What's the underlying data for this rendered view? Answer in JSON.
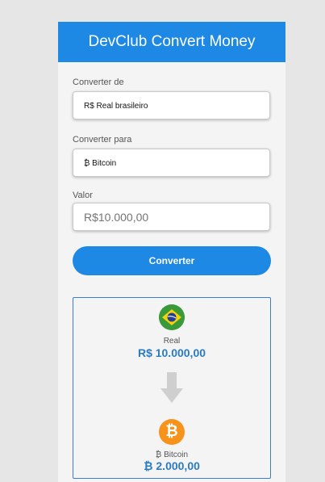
{
  "header": {
    "title": "DevClub Convert Money"
  },
  "form": {
    "from_label": "Converter de",
    "from_value": "R$ Real brasileiro",
    "to_label": "Converter para",
    "to_value": "₿ Bitcoin",
    "value_label": "Valor",
    "value_placeholder": "R$10.000,00",
    "convert_label": "Converter"
  },
  "result": {
    "from": {
      "icon": "brazil-flag-icon",
      "name": "Real",
      "value": "R$ 10.000,00"
    },
    "arrow_icon": "arrow-down-icon",
    "to": {
      "icon": "bitcoin-icon",
      "symbol": "₿",
      "name": "₿ Bitcoin",
      "value": "₿ 2.000,00"
    }
  },
  "colors": {
    "primary": "#1e88e5",
    "value_text": "#2b7bc0",
    "bitcoin": "#f7931a",
    "brazil_green": "#3a9a3a",
    "brazil_yellow": "#f5d20c",
    "brazil_blue": "#243f8f",
    "page_bg": "#e6e6e6",
    "card_bg": "#f4f4f4"
  }
}
